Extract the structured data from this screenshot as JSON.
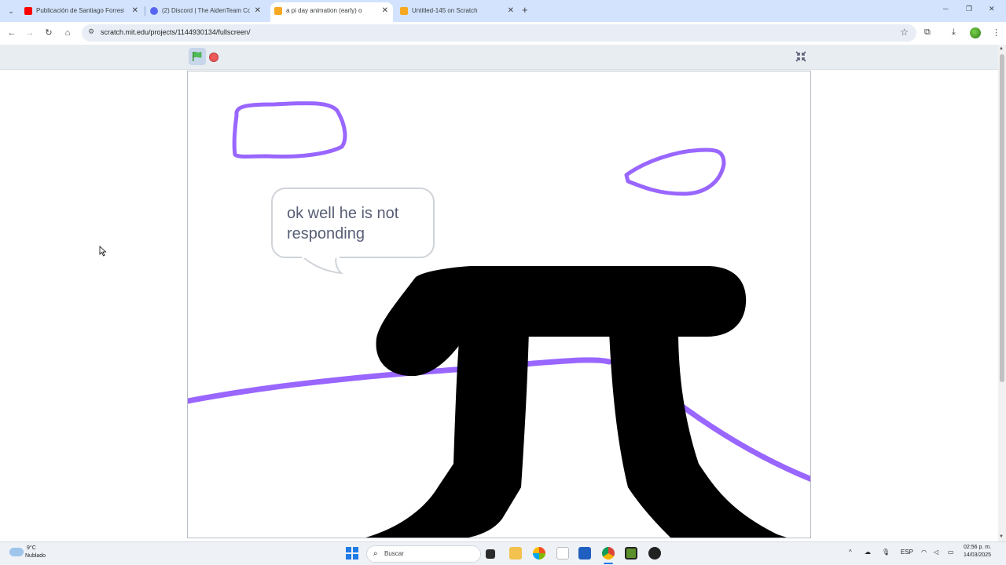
{
  "browser": {
    "tabs": [
      {
        "title": "Publicación de Santiago Forrest",
        "favicon": "youtube-icon",
        "color": "#ff0000"
      },
      {
        "title": "(2) Discord | The AidenTeam Co",
        "favicon": "discord-icon",
        "color": "#5865f2"
      },
      {
        "title": "a pi day animation (early) o",
        "favicon": "scratch-icon",
        "color": "#f7a823",
        "active": true
      },
      {
        "title": "Untitled-145 on Scratch",
        "favicon": "scratch-icon",
        "color": "#f7a823"
      }
    ],
    "url": "scratch.mit.edu/projects/1144930134/fullscreen/"
  },
  "stage": {
    "speech": "ok well he is not responding",
    "colors": {
      "purple": "#9966ff",
      "pi": "#000000"
    }
  },
  "taskbar": {
    "weather_temp": "9°C",
    "weather_desc": "Nublado",
    "search_placeholder": "Buscar",
    "lang": "ESP",
    "time": "02:56 p. m.",
    "date": "14/03/2025"
  }
}
